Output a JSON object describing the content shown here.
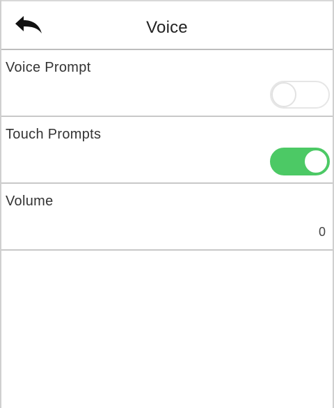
{
  "header": {
    "title": "Voice",
    "back_icon": "back-arrow-icon"
  },
  "settings": [
    {
      "label": "Voice Prompt",
      "control": "toggle",
      "state": "off"
    },
    {
      "label": "Touch Prompts",
      "control": "toggle",
      "state": "on"
    },
    {
      "label": "Volume",
      "control": "value",
      "value": "0"
    }
  ],
  "colors": {
    "toggle_on": "#4cc965",
    "toggle_off_border": "#e6e6e6",
    "divider": "#c8c8c8"
  }
}
